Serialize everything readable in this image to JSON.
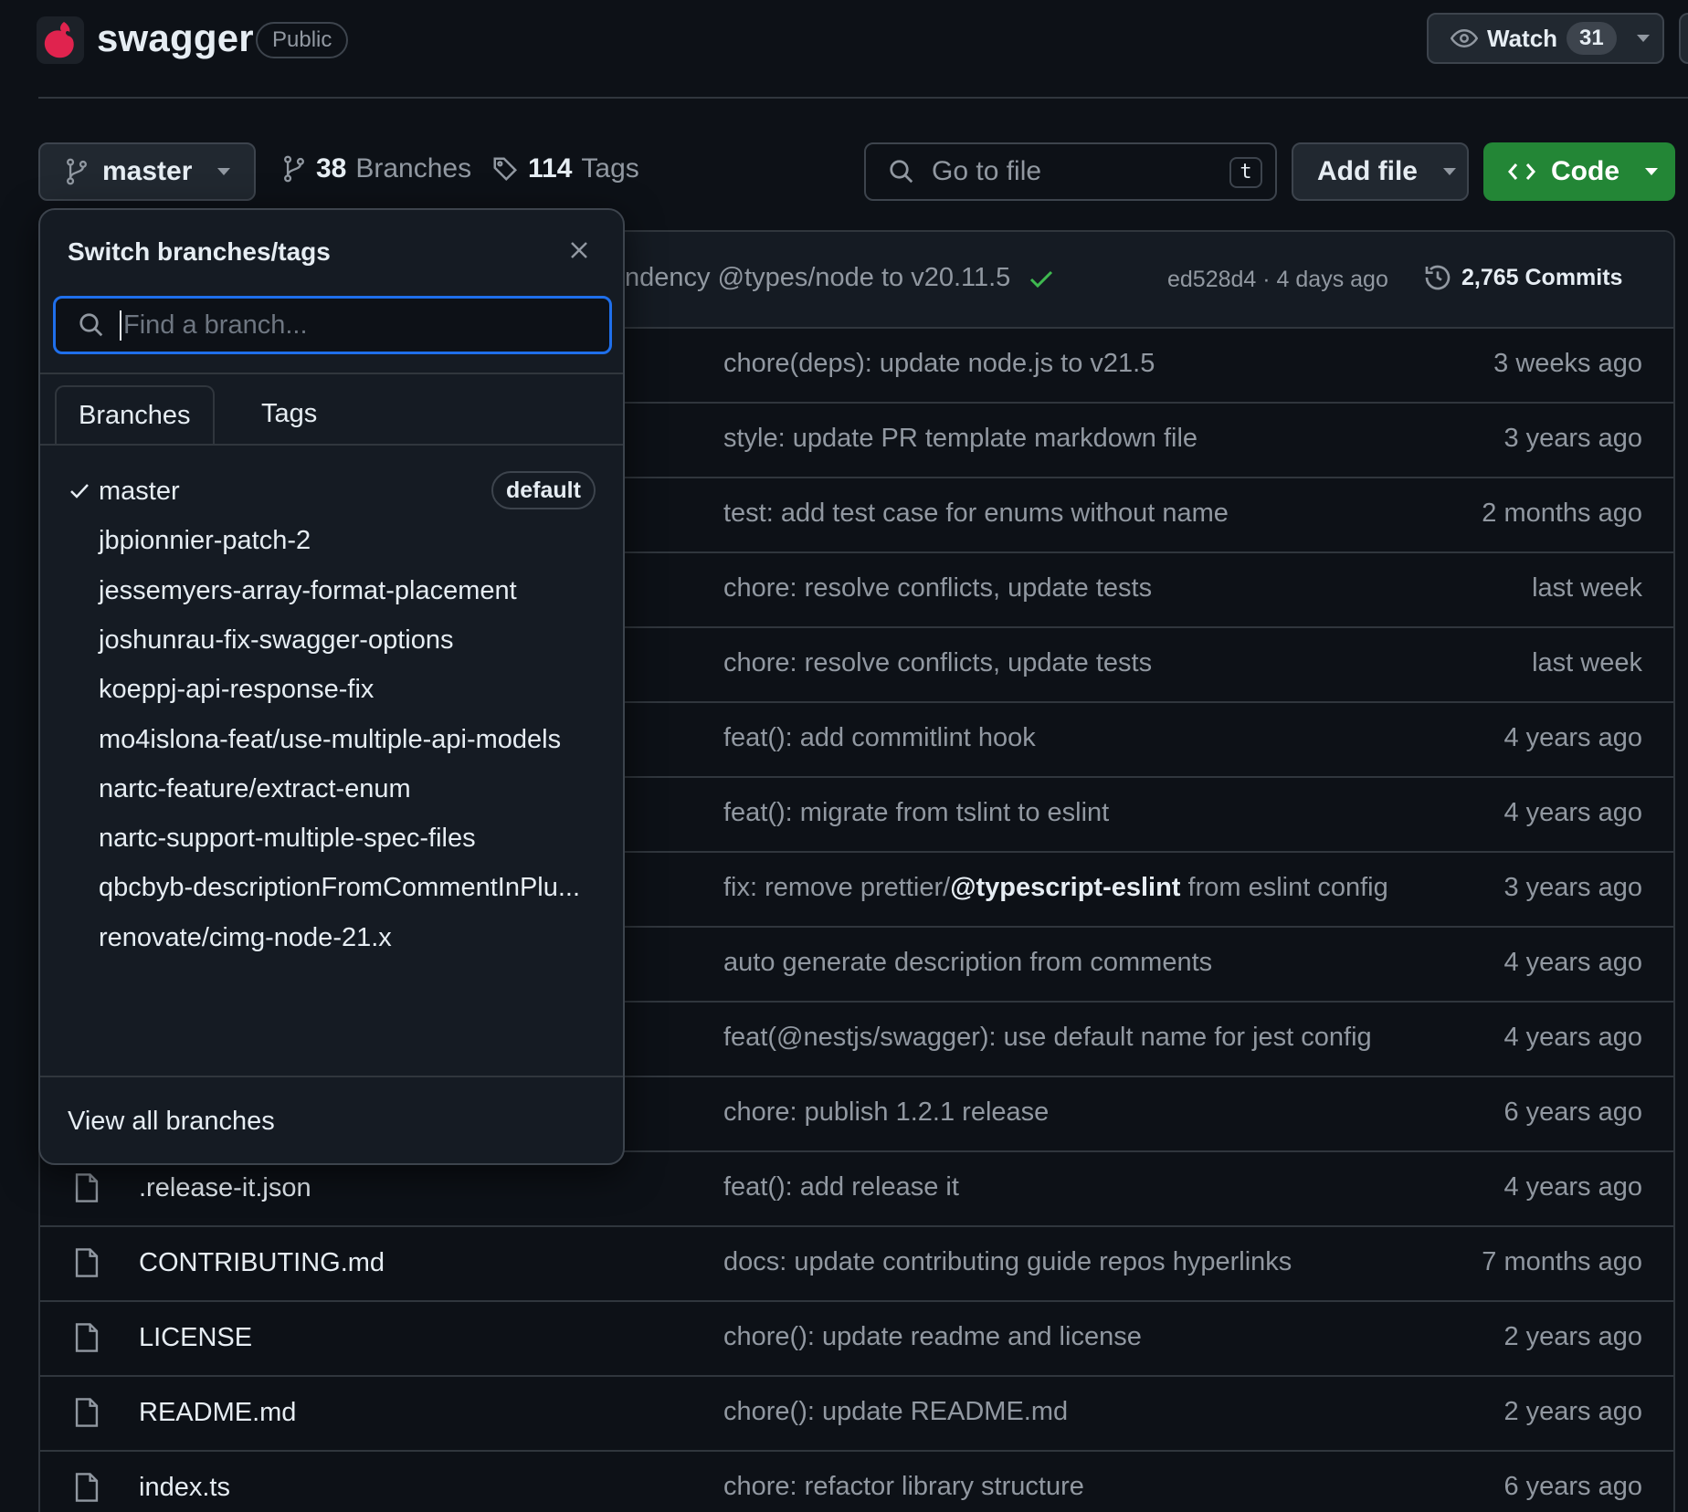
{
  "header": {
    "repo_name": "swagger",
    "visibility": "Public",
    "watch_label": "Watch",
    "watch_count": "31"
  },
  "toolbar": {
    "branch": "master",
    "branches_count": "38",
    "branches_label": "Branches",
    "tags_count": "114",
    "tags_label": "Tags",
    "goto_placeholder": "Go to file",
    "goto_shortcut": "t",
    "add_file_label": "Add file",
    "code_label": "Code"
  },
  "latest_commit": {
    "message": "ndency @types/node to v20.11.5",
    "hash_time": "ed528d4 · 4 days ago",
    "commits_label": "2,765 Commits"
  },
  "files": [
    {
      "name": "",
      "message": "chore(deps): update node.js to v21.5",
      "age": "3 weeks ago"
    },
    {
      "name": "",
      "message": "style: update PR template markdown file",
      "age": "3 years ago"
    },
    {
      "name": "",
      "message": "test: add test case for enums without name",
      "age": "2 months ago"
    },
    {
      "name": "",
      "message": "chore: resolve conflicts, update tests",
      "age": "last week"
    },
    {
      "name": "",
      "message": "chore: resolve conflicts, update tests",
      "age": "last week"
    },
    {
      "name": "",
      "message": "feat(): add commitlint hook",
      "age": "4 years ago"
    },
    {
      "name": "",
      "message": "feat(): migrate from tslint to eslint",
      "age": "4 years ago"
    },
    {
      "name": "",
      "message_pre": "fix: remove prettier/",
      "message_bold": "@typescript-eslint",
      "message_post": " from eslint config",
      "age": "3 years ago"
    },
    {
      "name": "",
      "message": "auto generate description from comments",
      "age": "4 years ago"
    },
    {
      "name": "",
      "message": "feat(@nestjs/swagger): use default name for jest config",
      "age": "4 years ago"
    },
    {
      "name": "",
      "message": "chore: publish 1.2.1 release",
      "age": "6 years ago"
    },
    {
      "name": ".release-it.json",
      "message": "feat(): add release it",
      "age": "4 years ago"
    },
    {
      "name": "CONTRIBUTING.md",
      "message": "docs: update contributing guide repos hyperlinks",
      "age": "7 months ago"
    },
    {
      "name": "LICENSE",
      "message": "chore(): update readme and license",
      "age": "2 years ago"
    },
    {
      "name": "README.md",
      "message": "chore(): update README.md",
      "age": "2 years ago"
    },
    {
      "name": "index.ts",
      "message": "chore: refactor library structure",
      "age": "6 years ago"
    }
  ],
  "branch_panel": {
    "title": "Switch branches/tags",
    "search_placeholder": "Find a branch...",
    "tab_branches": "Branches",
    "tab_tags": "Tags",
    "default_badge": "default",
    "branches": [
      "master",
      "jbpionnier-patch-2",
      "jessemyers-array-format-placement",
      "joshunrau-fix-swagger-options",
      "koeppj-api-response-fix",
      "mo4islona-feat/use-multiple-api-models",
      "nartc-feature/extract-enum",
      "nartc-support-multiple-spec-files",
      "qbcbyb-descriptionFromCommentInPlu...",
      "renovate/cimg-node-21.x"
    ],
    "view_all": "View all branches"
  },
  "colors": {
    "background": "#0d1117",
    "accent_blue": "#1f6feb",
    "code_green": "#238636",
    "check_green": "#3fb950"
  },
  "icons": [
    "nestjs-logo",
    "eye-icon",
    "branch-icon",
    "tag-icon",
    "search-icon",
    "code-icon",
    "check-icon",
    "history-icon",
    "file-icon",
    "close-icon",
    "caret-down-icon"
  ]
}
